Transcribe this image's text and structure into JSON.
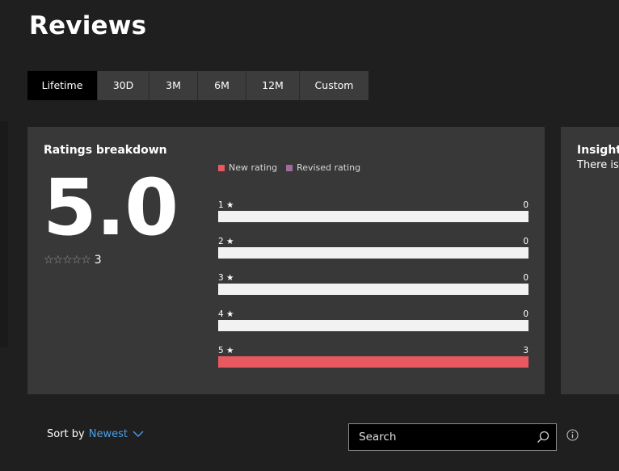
{
  "page": {
    "title": "Reviews"
  },
  "tabs": [
    {
      "label": "Lifetime",
      "active": true
    },
    {
      "label": "30D",
      "active": false
    },
    {
      "label": "3M",
      "active": false
    },
    {
      "label": "6M",
      "active": false
    },
    {
      "label": "12M",
      "active": false
    },
    {
      "label": "Custom",
      "active": false
    }
  ],
  "ratings": {
    "title": "Ratings breakdown",
    "average": "5.0",
    "stars_glyph": "☆☆☆☆☆",
    "total_count": "3",
    "legend": [
      {
        "label": "New rating",
        "color": "#e8585e"
      },
      {
        "label": "Revised rating",
        "color": "#a36a9f"
      }
    ],
    "bars": [
      {
        "label": "1 ★",
        "count": "0",
        "fraction": 0
      },
      {
        "label": "2 ★",
        "count": "0",
        "fraction": 0
      },
      {
        "label": "3 ★",
        "count": "0",
        "fraction": 0
      },
      {
        "label": "4 ★",
        "count": "0",
        "fraction": 0
      },
      {
        "label": "5 ★",
        "count": "3",
        "fraction": 1
      }
    ]
  },
  "insights": {
    "title": "Insight",
    "text": "There is"
  },
  "sort": {
    "label": "Sort by",
    "value": "Newest"
  },
  "search": {
    "placeholder": "Search"
  },
  "colors": {
    "accent": "#4a9fe8",
    "new_rating": "#e8585e",
    "revised_rating": "#a36a9f",
    "bar_track": "#f2f2f2"
  }
}
